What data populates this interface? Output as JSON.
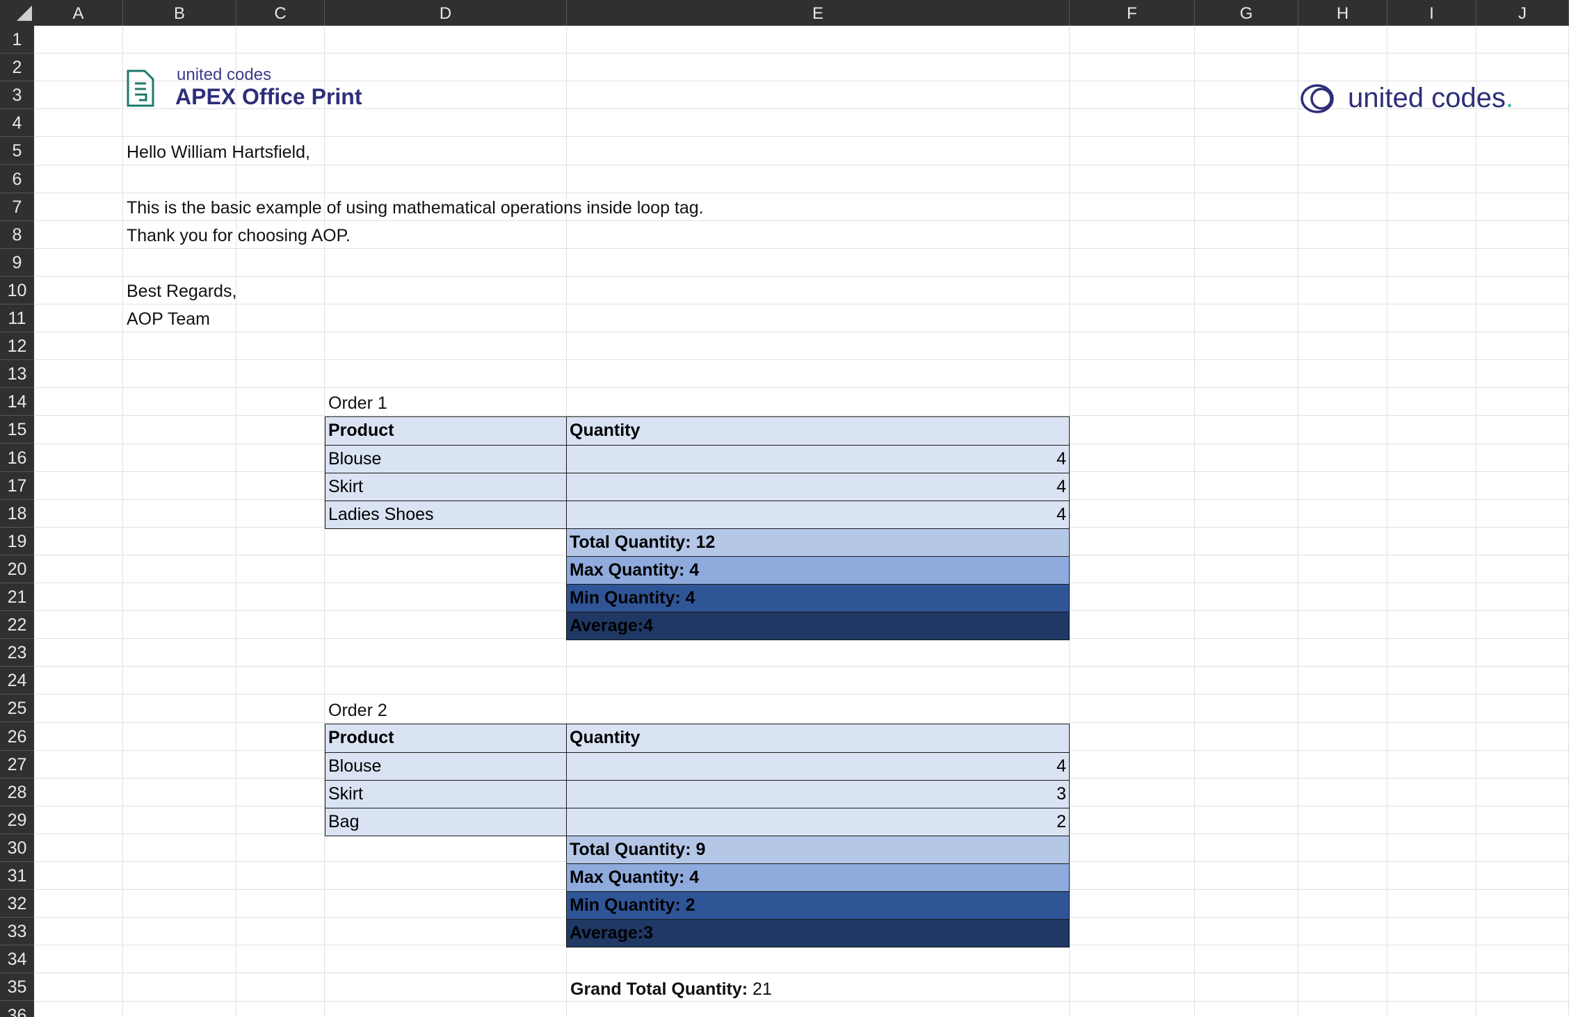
{
  "columns": [
    "A",
    "B",
    "C",
    "D",
    "E",
    "F",
    "G",
    "H",
    "I",
    "J"
  ],
  "rows": [
    "1",
    "2",
    "3",
    "4",
    "5",
    "6",
    "7",
    "8",
    "9",
    "10",
    "11",
    "12",
    "13",
    "14",
    "15",
    "16",
    "17",
    "18",
    "19",
    "20",
    "21",
    "22",
    "23",
    "24",
    "25",
    "26",
    "27",
    "28",
    "29",
    "30",
    "31",
    "32",
    "33",
    "34",
    "35",
    "36"
  ],
  "logo": {
    "sub": "united codes",
    "main": "APEX Office Print",
    "right_text": "united codes",
    "right_dot": ".",
    "accent": "#2e2e7a",
    "icon_green": "#1c7a6b"
  },
  "letter": {
    "greeting": "Hello William Hartsfield,",
    "line1": "This is the basic example of using mathematical operations inside loop tag.",
    "line2": "Thank you for choosing AOP.",
    "closing": "Best Regards,",
    "signature": "AOP Team"
  },
  "orders": [
    {
      "title": "Order 1",
      "header": {
        "product": "Product",
        "quantity": "Quantity"
      },
      "items": [
        {
          "product": "Blouse",
          "quantity": "4"
        },
        {
          "product": "Skirt",
          "quantity": "4"
        },
        {
          "product": "Ladies Shoes",
          "quantity": "4"
        }
      ],
      "total": "Total Quantity: 12",
      "max": "Max Quantity: 4",
      "min": "Min Quantity: 4",
      "average": "Average:4"
    },
    {
      "title": "Order 2",
      "header": {
        "product": "Product",
        "quantity": "Quantity"
      },
      "items": [
        {
          "product": "Blouse",
          "quantity": "4"
        },
        {
          "product": "Skirt",
          "quantity": "3"
        },
        {
          "product": "Bag",
          "quantity": "2"
        }
      ],
      "total": "Total Quantity: 9",
      "max": "Max Quantity: 4",
      "min": "Min Quantity: 2",
      "average": "Average:3"
    }
  ],
  "grand_total": {
    "label": "Grand Total Quantity:",
    "value": "21"
  },
  "colors": {
    "header_bg": "#303030",
    "light_fill": "#dae3f3",
    "total_fill": "#b4c7e7",
    "max_fill": "#8faadc",
    "min_fill": "#2f5597",
    "avg_fill": "#1f3864"
  }
}
